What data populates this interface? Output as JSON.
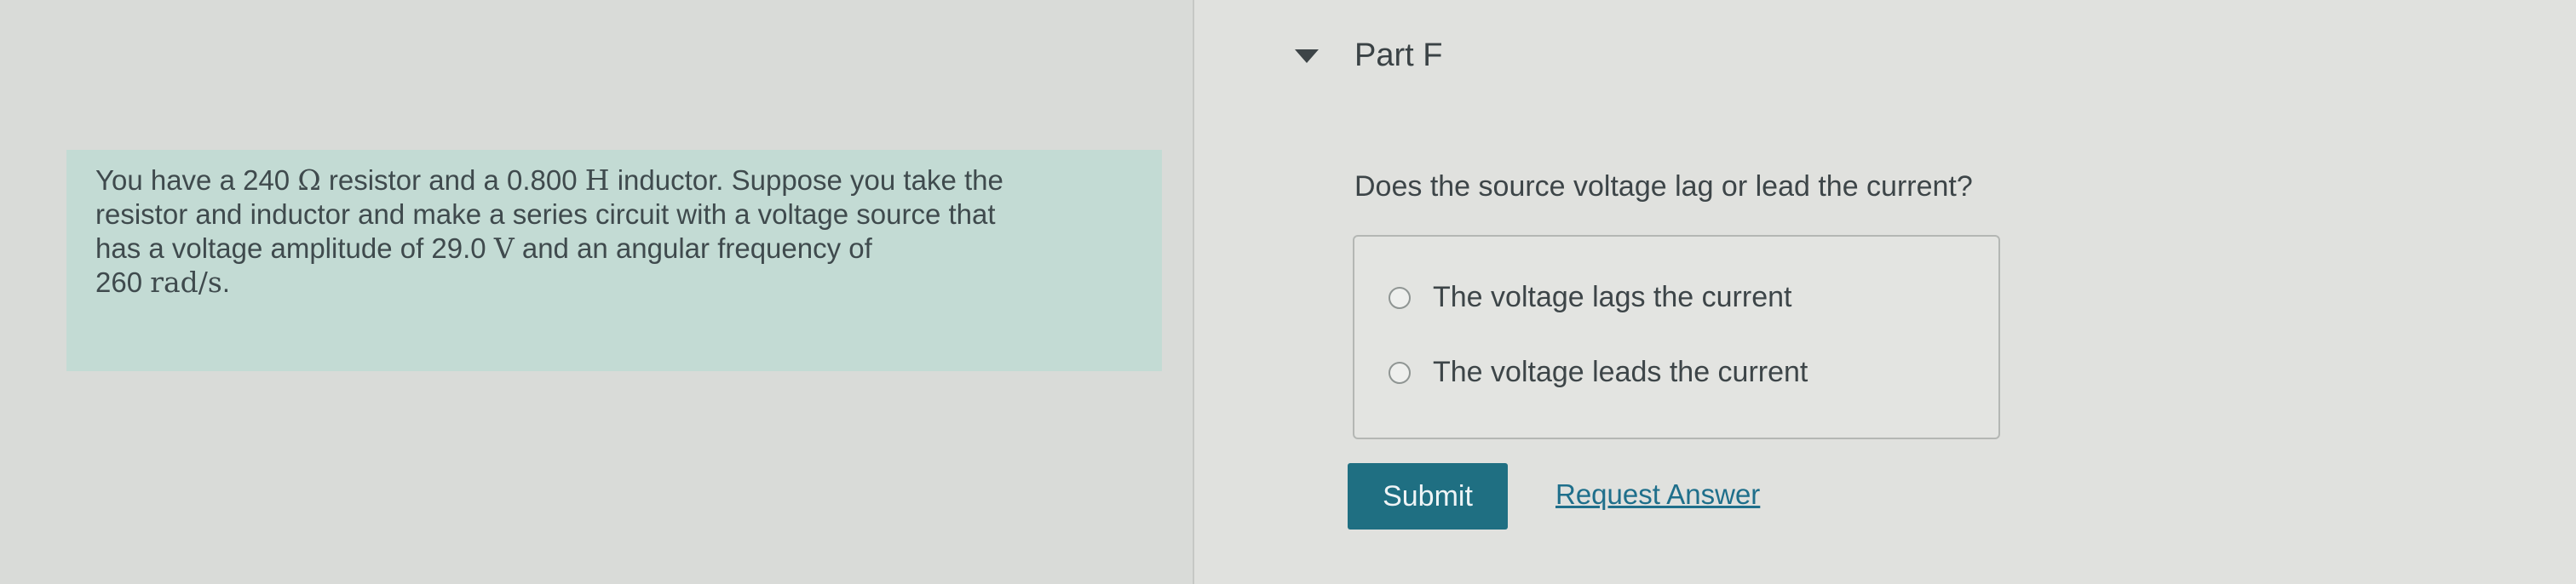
{
  "problem": {
    "line1_a": "You have a 240 ",
    "ohm_symbol": "Ω",
    "line1_b": " resistor and a 0.800 ",
    "henry_symbol": "H",
    "line1_c": " inductor. Suppose you take the",
    "line2": "resistor and inductor and make a series circuit with a voltage source that",
    "line3_a": "has a voltage amplitude of 29.0 ",
    "volt_symbol": "V",
    "line3_b": " and an angular frequency of",
    "line4_a": "260 ",
    "rad_unit": "rad/s",
    "line4_b": "."
  },
  "part": {
    "title": "Part F",
    "question": "Does the source voltage lag or lead the current?",
    "options": [
      {
        "label": "The voltage lags the current"
      },
      {
        "label": "The voltage leads the current"
      }
    ]
  },
  "actions": {
    "submit_label": "Submit",
    "request_answer_label": "Request Answer"
  },
  "colors": {
    "problem_background": "#c3dbd4",
    "submit_background": "#1f6f82",
    "link": "#1f6f8b"
  }
}
